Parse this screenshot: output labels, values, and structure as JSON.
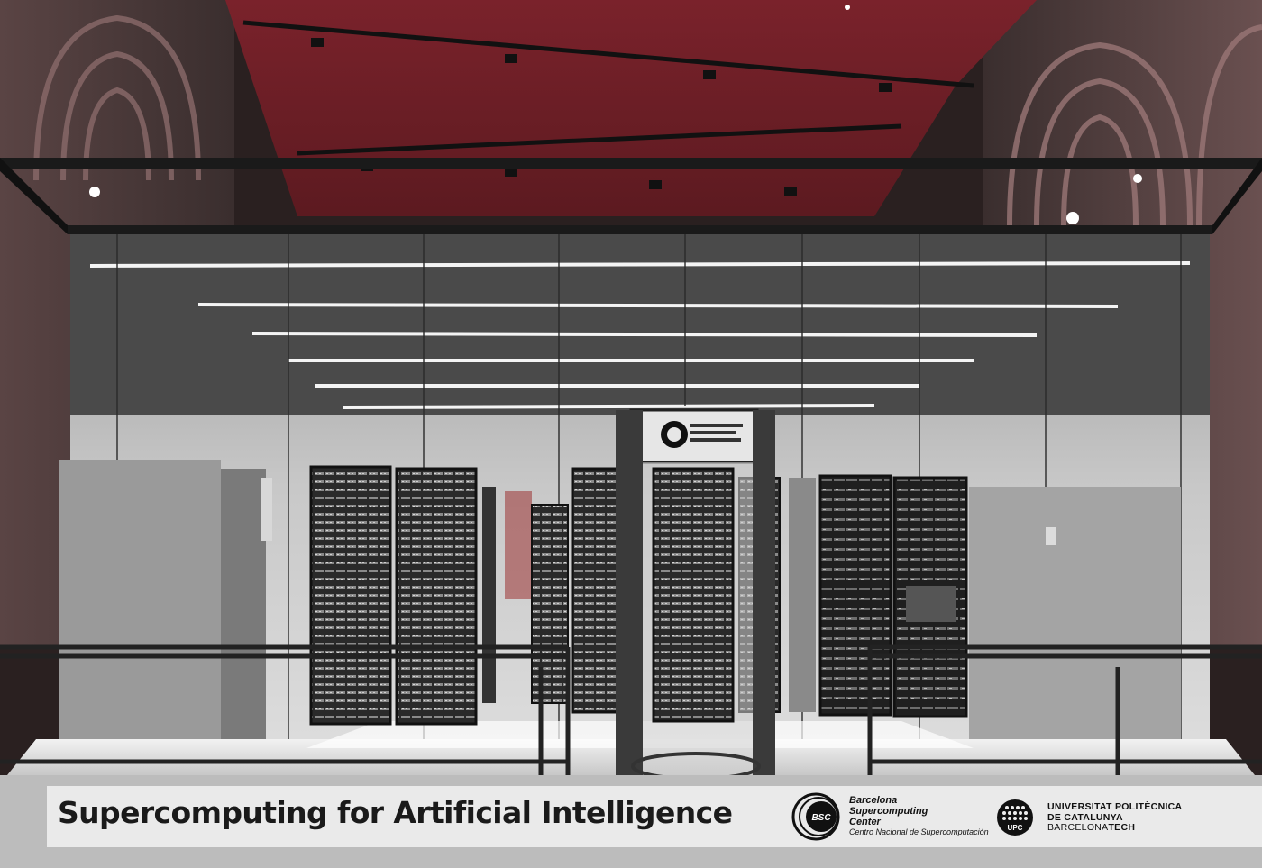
{
  "banner": {
    "title": "Supercomputing for Artificial Intelligence",
    "bsc": {
      "name": "Barcelona Supercomputing Center",
      "subtitle": "Centro Nacional de Supercomputación",
      "logo_text": "BSC"
    },
    "upc": {
      "line1": "UNIVERSITAT POLITÈCNICA",
      "line2": "DE CATALUNYA",
      "line3_a": "BARCELONA",
      "line3_b": "TECH",
      "logo_text": "UPC"
    }
  },
  "scene": {
    "door_sign": "Barcelona Supercomputing Center",
    "colors": {
      "ceiling": "#6e1f26",
      "glass_frame": "#1a1a1a",
      "floor": "#e8e8e8",
      "rack": "#2a2a2a"
    }
  }
}
